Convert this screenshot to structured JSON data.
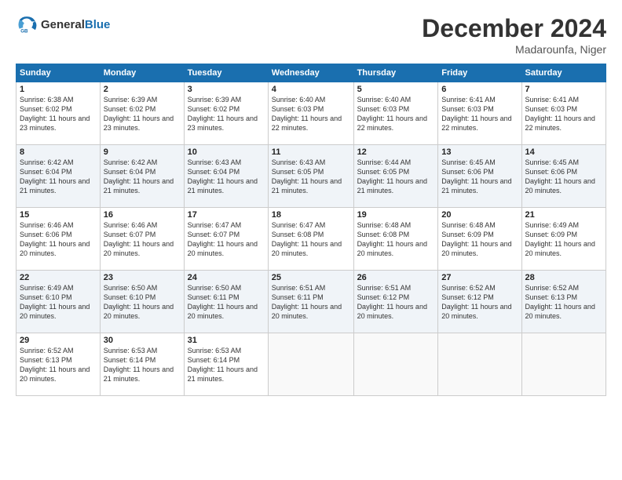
{
  "header": {
    "logo_general": "General",
    "logo_blue": "Blue",
    "month_title": "December 2024",
    "location": "Madarounfa, Niger"
  },
  "weekdays": [
    "Sunday",
    "Monday",
    "Tuesday",
    "Wednesday",
    "Thursday",
    "Friday",
    "Saturday"
  ],
  "weeks": [
    [
      {
        "day": "1",
        "sunrise": "6:38 AM",
        "sunset": "6:02 PM",
        "daylight": "11 hours and 23 minutes."
      },
      {
        "day": "2",
        "sunrise": "6:39 AM",
        "sunset": "6:02 PM",
        "daylight": "11 hours and 23 minutes."
      },
      {
        "day": "3",
        "sunrise": "6:39 AM",
        "sunset": "6:02 PM",
        "daylight": "11 hours and 23 minutes."
      },
      {
        "day": "4",
        "sunrise": "6:40 AM",
        "sunset": "6:03 PM",
        "daylight": "11 hours and 22 minutes."
      },
      {
        "day": "5",
        "sunrise": "6:40 AM",
        "sunset": "6:03 PM",
        "daylight": "11 hours and 22 minutes."
      },
      {
        "day": "6",
        "sunrise": "6:41 AM",
        "sunset": "6:03 PM",
        "daylight": "11 hours and 22 minutes."
      },
      {
        "day": "7",
        "sunrise": "6:41 AM",
        "sunset": "6:03 PM",
        "daylight": "11 hours and 22 minutes."
      }
    ],
    [
      {
        "day": "8",
        "sunrise": "6:42 AM",
        "sunset": "6:04 PM",
        "daylight": "11 hours and 21 minutes."
      },
      {
        "day": "9",
        "sunrise": "6:42 AM",
        "sunset": "6:04 PM",
        "daylight": "11 hours and 21 minutes."
      },
      {
        "day": "10",
        "sunrise": "6:43 AM",
        "sunset": "6:04 PM",
        "daylight": "11 hours and 21 minutes."
      },
      {
        "day": "11",
        "sunrise": "6:43 AM",
        "sunset": "6:05 PM",
        "daylight": "11 hours and 21 minutes."
      },
      {
        "day": "12",
        "sunrise": "6:44 AM",
        "sunset": "6:05 PM",
        "daylight": "11 hours and 21 minutes."
      },
      {
        "day": "13",
        "sunrise": "6:45 AM",
        "sunset": "6:06 PM",
        "daylight": "11 hours and 21 minutes."
      },
      {
        "day": "14",
        "sunrise": "6:45 AM",
        "sunset": "6:06 PM",
        "daylight": "11 hours and 20 minutes."
      }
    ],
    [
      {
        "day": "15",
        "sunrise": "6:46 AM",
        "sunset": "6:06 PM",
        "daylight": "11 hours and 20 minutes."
      },
      {
        "day": "16",
        "sunrise": "6:46 AM",
        "sunset": "6:07 PM",
        "daylight": "11 hours and 20 minutes."
      },
      {
        "day": "17",
        "sunrise": "6:47 AM",
        "sunset": "6:07 PM",
        "daylight": "11 hours and 20 minutes."
      },
      {
        "day": "18",
        "sunrise": "6:47 AM",
        "sunset": "6:08 PM",
        "daylight": "11 hours and 20 minutes."
      },
      {
        "day": "19",
        "sunrise": "6:48 AM",
        "sunset": "6:08 PM",
        "daylight": "11 hours and 20 minutes."
      },
      {
        "day": "20",
        "sunrise": "6:48 AM",
        "sunset": "6:09 PM",
        "daylight": "11 hours and 20 minutes."
      },
      {
        "day": "21",
        "sunrise": "6:49 AM",
        "sunset": "6:09 PM",
        "daylight": "11 hours and 20 minutes."
      }
    ],
    [
      {
        "day": "22",
        "sunrise": "6:49 AM",
        "sunset": "6:10 PM",
        "daylight": "11 hours and 20 minutes."
      },
      {
        "day": "23",
        "sunrise": "6:50 AM",
        "sunset": "6:10 PM",
        "daylight": "11 hours and 20 minutes."
      },
      {
        "day": "24",
        "sunrise": "6:50 AM",
        "sunset": "6:11 PM",
        "daylight": "11 hours and 20 minutes."
      },
      {
        "day": "25",
        "sunrise": "6:51 AM",
        "sunset": "6:11 PM",
        "daylight": "11 hours and 20 minutes."
      },
      {
        "day": "26",
        "sunrise": "6:51 AM",
        "sunset": "6:12 PM",
        "daylight": "11 hours and 20 minutes."
      },
      {
        "day": "27",
        "sunrise": "6:52 AM",
        "sunset": "6:12 PM",
        "daylight": "11 hours and 20 minutes."
      },
      {
        "day": "28",
        "sunrise": "6:52 AM",
        "sunset": "6:13 PM",
        "daylight": "11 hours and 20 minutes."
      }
    ],
    [
      {
        "day": "29",
        "sunrise": "6:52 AM",
        "sunset": "6:13 PM",
        "daylight": "11 hours and 20 minutes."
      },
      {
        "day": "30",
        "sunrise": "6:53 AM",
        "sunset": "6:14 PM",
        "daylight": "11 hours and 21 minutes."
      },
      {
        "day": "31",
        "sunrise": "6:53 AM",
        "sunset": "6:14 PM",
        "daylight": "11 hours and 21 minutes."
      },
      null,
      null,
      null,
      null
    ]
  ]
}
